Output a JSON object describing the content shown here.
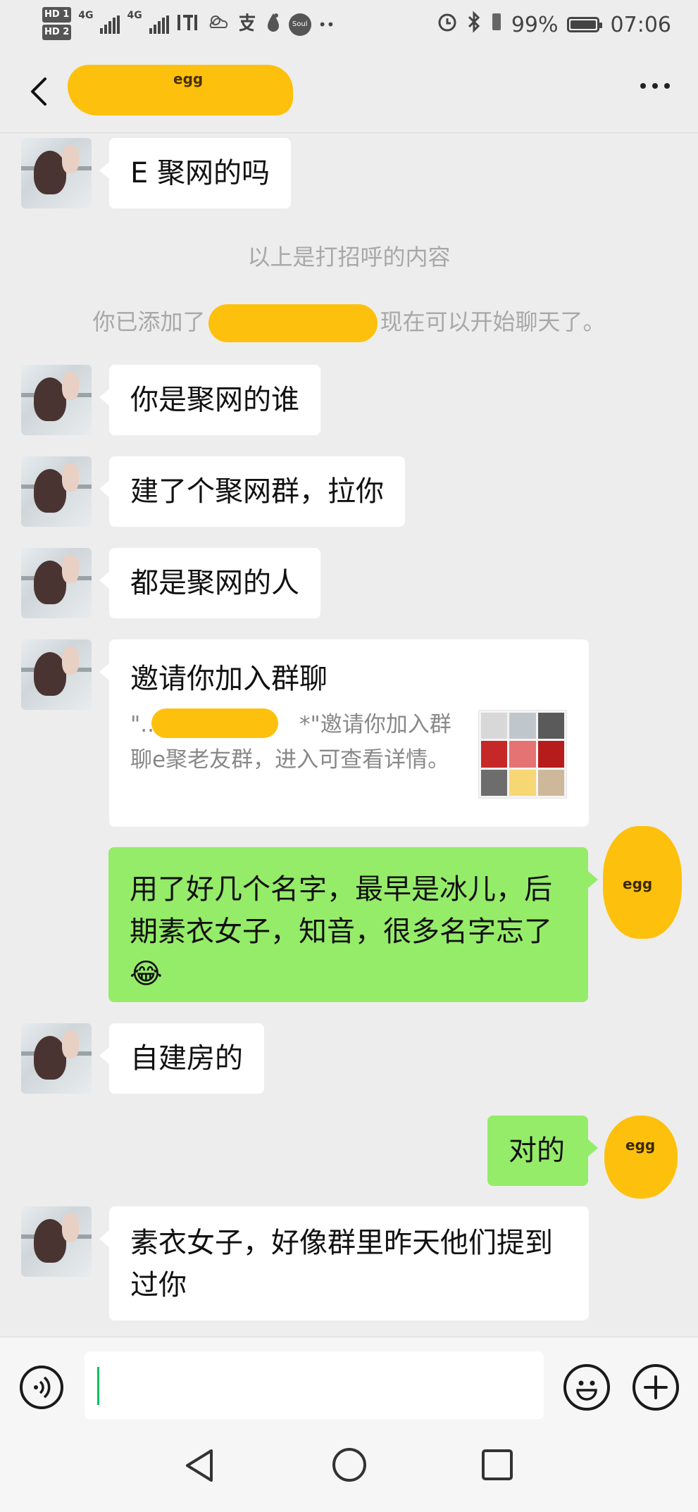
{
  "status_bar": {
    "hd1": "HD 1",
    "hd2": "HD 2",
    "net1": "4G",
    "net2": "4G",
    "battery_percent": "99%",
    "time": "07:06"
  },
  "nav": {
    "title_egg_text": "egg"
  },
  "messages": [
    {
      "id": "m1",
      "side": "left",
      "text": "E 聚网的吗"
    },
    {
      "id": "sys1",
      "type": "system",
      "text": "以上是打招呼的内容"
    },
    {
      "id": "sys2",
      "type": "system",
      "prefix": "你已添加了",
      "suffix": "现在可以开始聊天了。"
    },
    {
      "id": "m2",
      "side": "left",
      "text": "你是聚网的谁"
    },
    {
      "id": "m3",
      "side": "left",
      "text": "建了个聚网群，拉你"
    },
    {
      "id": "m4",
      "side": "left",
      "text": "都是聚网的人"
    },
    {
      "id": "m5",
      "side": "left",
      "type": "invite_card",
      "title": "邀请你加入群聊",
      "desc_prefix": "\"..",
      "desc_rest": "*\"邀请你加入群聊e聚老友群，进入可查看详情。"
    },
    {
      "id": "m6",
      "side": "right",
      "text": "用了好几个名字，最早是冰儿，后期素衣女子，知音，很多名字忘了",
      "emoji": "😂"
    },
    {
      "id": "m7",
      "side": "left",
      "text": "自建房的"
    },
    {
      "id": "m8",
      "side": "right",
      "text": "对的"
    },
    {
      "id": "m9",
      "side": "left",
      "text": "素衣女子，好像群里昨天他们提到过你"
    }
  ],
  "input_bar": {
    "voice_icon": "voice-icon",
    "emoji_icon": "emoji-icon",
    "add_icon": "plus-icon",
    "value": ""
  },
  "colors": {
    "background": "#ededed",
    "bubble_green": "#95ec69",
    "bubble_white": "#ffffff",
    "redaction_yellow": "#fdc10d"
  }
}
